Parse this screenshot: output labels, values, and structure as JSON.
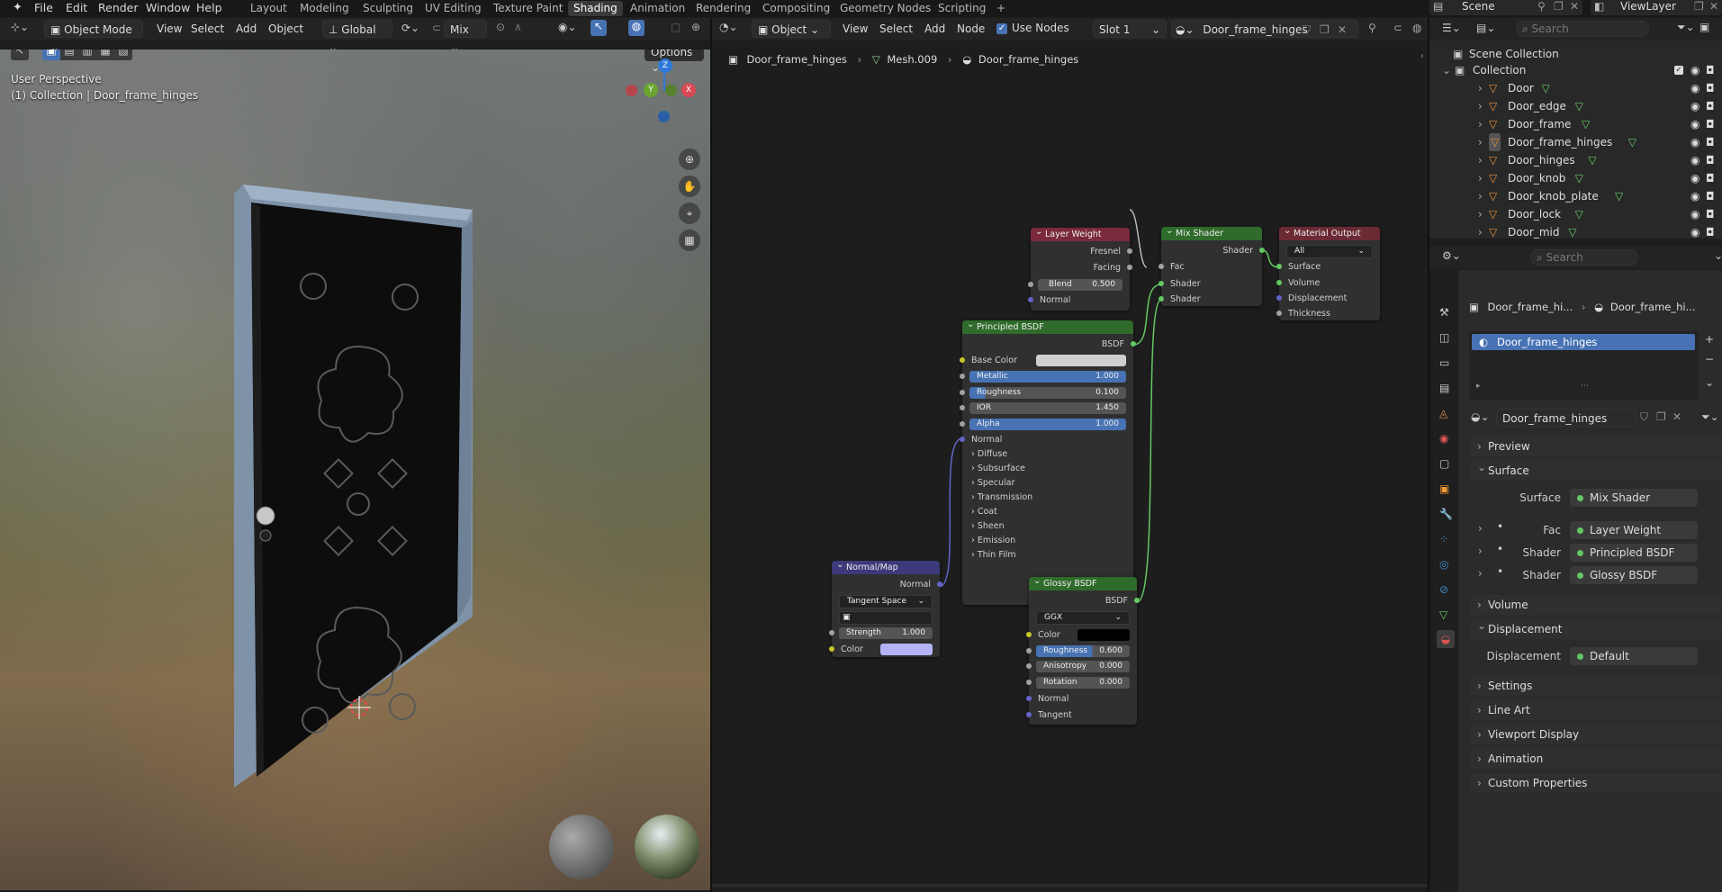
{
  "topbar": {
    "menus": [
      "File",
      "Edit",
      "Render",
      "Window",
      "Help"
    ],
    "workspaces": [
      "Layout",
      "Modeling",
      "Sculpting",
      "UV Editing",
      "Texture Paint",
      "Shading",
      "Animation",
      "Rendering",
      "Compositing",
      "Geometry Nodes",
      "Scripting"
    ],
    "active_workspace": "Shading",
    "add_tab": "+",
    "scene": "Scene",
    "view_layer": "ViewLayer"
  },
  "viewport": {
    "mode": "Object Mode",
    "menus": [
      "View",
      "Select",
      "Add",
      "Object"
    ],
    "transform_orientation": "Global",
    "pivot": "Mix",
    "options": "Options",
    "info_line1": "User Perspective",
    "info_line2": "(1) Collection | Door_frame_hinges",
    "gizmo": {
      "z": "Z",
      "y": "Y",
      "x": "X"
    }
  },
  "node_editor": {
    "type": "Object",
    "menus": [
      "View",
      "Select",
      "Add",
      "Node"
    ],
    "use_nodes_label": "Use Nodes",
    "slot": "Slot 1",
    "material": "Door_frame_hinges",
    "breadcrumb": [
      "Door_frame_hinges",
      "Mesh.009",
      "Door_frame_hinges"
    ],
    "nodes": {
      "layer_weight": {
        "title": "Layer Weight",
        "out1": "Fresnel",
        "out2": "Facing",
        "blend_label": "Blend",
        "blend": "0.500",
        "normal": "Normal"
      },
      "mix_shader": {
        "title": "Mix Shader",
        "out": "Shader",
        "fac": "Fac",
        "in1": "Shader",
        "in2": "Shader"
      },
      "material_output": {
        "title": "Material Output",
        "target": "All",
        "surface": "Surface",
        "volume": "Volume",
        "displacement": "Displacement",
        "thickness": "Thickness"
      },
      "principled": {
        "title": "Principled BSDF",
        "out": "BSDF",
        "base_color": "Base Color",
        "metallic_label": "Metallic",
        "metallic": "1.000",
        "roughness_label": "Roughness",
        "roughness": "0.100",
        "ior_label": "IOR",
        "ior": "1.450",
        "alpha_label": "Alpha",
        "alpha": "1.000",
        "normal": "Normal",
        "sections": [
          "Diffuse",
          "Subsurface",
          "Specular",
          "Transmission",
          "Coat",
          "Sheen",
          "Emission",
          "Thin Film"
        ]
      },
      "normal_map": {
        "title": "Normal/Map",
        "out": "Normal",
        "space": "Tangent Space",
        "strength_label": "Strength",
        "strength": "1.000",
        "color": "Color"
      },
      "glossy": {
        "title": "Glossy BSDF",
        "out": "BSDF",
        "distribution": "GGX",
        "color": "Color",
        "roughness_label": "Roughness",
        "roughness": "0.600",
        "aniso_label": "Anisotropy",
        "aniso": "0.000",
        "rotation_label": "Rotation",
        "rotation": "0.000",
        "normal": "Normal",
        "tangent": "Tangent"
      }
    }
  },
  "outliner": {
    "search_placeholder": "Search",
    "scene_collection": "Scene Collection",
    "collection": "Collection",
    "objects": [
      "Door",
      "Door_edge",
      "Door_frame",
      "Door_frame_hinges",
      "Door_hinges",
      "Door_knob",
      "Door_knob_plate",
      "Door_lock",
      "Door_mid"
    ]
  },
  "properties": {
    "search_placeholder": "Search",
    "breadcrumb_obj": "Door_frame_hi...",
    "breadcrumb_mat": "Door_frame_hi...",
    "slot_name": "Door_frame_hinges",
    "material_name": "Door_frame_hinges",
    "panels": {
      "preview": "Preview",
      "surface": "Surface",
      "volume": "Volume",
      "displacement": "Displacement",
      "settings": "Settings",
      "line_art": "Line Art",
      "viewport_display": "Viewport Display",
      "animation": "Animation",
      "custom_props": "Custom Properties"
    },
    "surface_label": "Surface",
    "surface_value": "Mix Shader",
    "fac_label": "Fac",
    "fac_value": "Layer Weight",
    "shader1_label": "Shader",
    "shader1_value": "Principled BSDF",
    "shader2_label": "Shader",
    "shader2_value": "Glossy BSDF",
    "disp_label": "Displacement",
    "disp_value": "Default"
  },
  "colors": {
    "accent": "#4772b3",
    "shader_header": "#2f6b2a",
    "input_header": "#7a2a3b",
    "output_header": "#6b2a34",
    "vector_header": "#3c3a7a"
  }
}
